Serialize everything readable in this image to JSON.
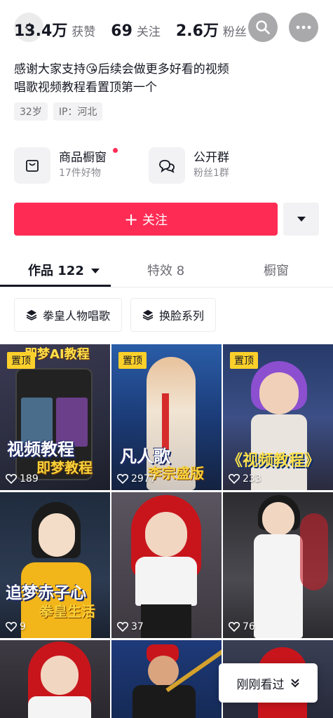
{
  "stats": [
    {
      "value": "13.4万",
      "label": "获赞"
    },
    {
      "value": "69",
      "label": "关注"
    },
    {
      "value": "2.6万",
      "label": "粉丝"
    }
  ],
  "bio": {
    "line1": "感谢大家支持😘后续会做更多好看的视频",
    "line2": "唱歌视频教程看置顶第一个"
  },
  "tags": [
    "32岁",
    "IP：河北"
  ],
  "shortcuts": {
    "shop": {
      "title": "商品橱窗",
      "subtitle": "17件好物"
    },
    "group": {
      "title": "公开群",
      "subtitle": "粉丝1群"
    }
  },
  "follow": {
    "label": "关注",
    "plus": "+"
  },
  "tabs": [
    {
      "label": "作品 122"
    },
    {
      "label": "特效 8"
    },
    {
      "label": "橱窗"
    }
  ],
  "collections": [
    "拳皇人物唱歌",
    "换脸系列"
  ],
  "videos": [
    {
      "pinned": "置顶",
      "likes": "189",
      "title": "视频教程",
      "subtitle": "即梦教程",
      "top_text": "即梦AI教程"
    },
    {
      "pinned": "置顶",
      "likes": "2977",
      "title": "凡人歌",
      "subtitle": "李宗盛版"
    },
    {
      "pinned": "置顶",
      "likes": "233",
      "title": "《视频教程》"
    },
    {
      "likes": "9",
      "title": "追梦赤子心",
      "subtitle": "拳皇生活"
    },
    {
      "likes": "37"
    },
    {
      "likes": "76"
    },
    {},
    {},
    {}
  ],
  "floating": {
    "recent_label": "刚刚看过"
  },
  "colors": {
    "accent": "#fe2c55",
    "pin": "#fbd02b"
  }
}
